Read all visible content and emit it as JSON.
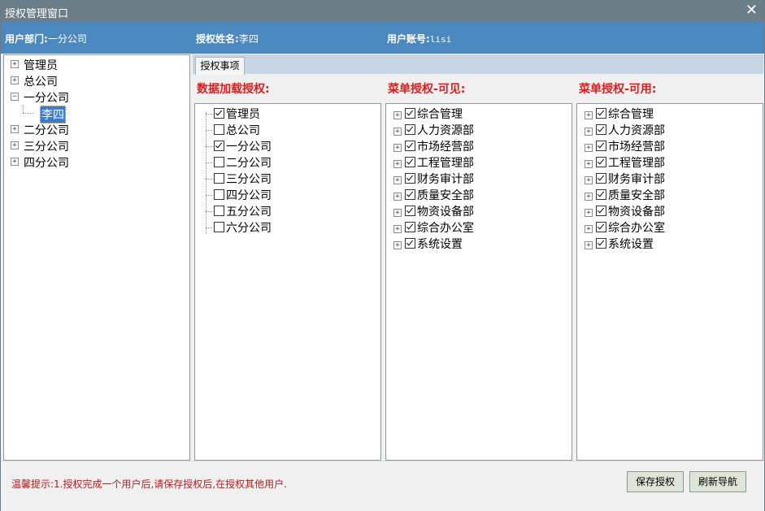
{
  "window": {
    "title": "授权管理窗口"
  },
  "info": {
    "dept_label": "用户部门:",
    "dept_value": "一分公司",
    "name_label": "授权姓名:",
    "name_value": "李四",
    "account_label": "用户账号:",
    "account_value": "lisi"
  },
  "org_tree": [
    {
      "label": "管理员",
      "expander": "+",
      "level": 0
    },
    {
      "label": "总公司",
      "expander": "+",
      "level": 0
    },
    {
      "label": "一分公司",
      "expander": "-",
      "level": 0
    },
    {
      "label": "李四",
      "expander": "",
      "level": 1,
      "selected": true
    },
    {
      "label": "二分公司",
      "expander": "+",
      "level": 0
    },
    {
      "label": "三分公司",
      "expander": "+",
      "level": 0
    },
    {
      "label": "四分公司",
      "expander": "+",
      "level": 0
    }
  ],
  "tab": {
    "label": "授权事项"
  },
  "data_auth": {
    "title": "数据加载授权:",
    "items": [
      {
        "label": "管理员",
        "checked": true
      },
      {
        "label": "总公司",
        "checked": false
      },
      {
        "label": "一分公司",
        "checked": true
      },
      {
        "label": "二分公司",
        "checked": false
      },
      {
        "label": "三分公司",
        "checked": false
      },
      {
        "label": "四分公司",
        "checked": false
      },
      {
        "label": "五分公司",
        "checked": false
      },
      {
        "label": "六分公司",
        "checked": false
      }
    ]
  },
  "menu_visible": {
    "title": "菜单授权-可见:",
    "items": [
      {
        "label": "综合管理",
        "checked": true
      },
      {
        "label": "人力资源部",
        "checked": true
      },
      {
        "label": "市场经营部",
        "checked": true
      },
      {
        "label": "工程管理部",
        "checked": true
      },
      {
        "label": "财务审计部",
        "checked": true
      },
      {
        "label": "质量安全部",
        "checked": true
      },
      {
        "label": "物资设备部",
        "checked": true
      },
      {
        "label": "综合办公室",
        "checked": true
      },
      {
        "label": "系统设置",
        "checked": true
      }
    ]
  },
  "menu_usable": {
    "title": "菜单授权-可用:",
    "items": [
      {
        "label": "综合管理",
        "checked": true
      },
      {
        "label": "人力资源部",
        "checked": true
      },
      {
        "label": "市场经营部",
        "checked": true
      },
      {
        "label": "工程管理部",
        "checked": true
      },
      {
        "label": "财务审计部",
        "checked": true
      },
      {
        "label": "质量安全部",
        "checked": true
      },
      {
        "label": "物资设备部",
        "checked": true
      },
      {
        "label": "综合办公室",
        "checked": true
      },
      {
        "label": "系统设置",
        "checked": true
      }
    ]
  },
  "footer": {
    "hint": "温馨提示:1.授权完成一个用户后,请保存授权后,在授权其他用户.",
    "save_label": "保存授权",
    "refresh_label": "刷新导航"
  }
}
